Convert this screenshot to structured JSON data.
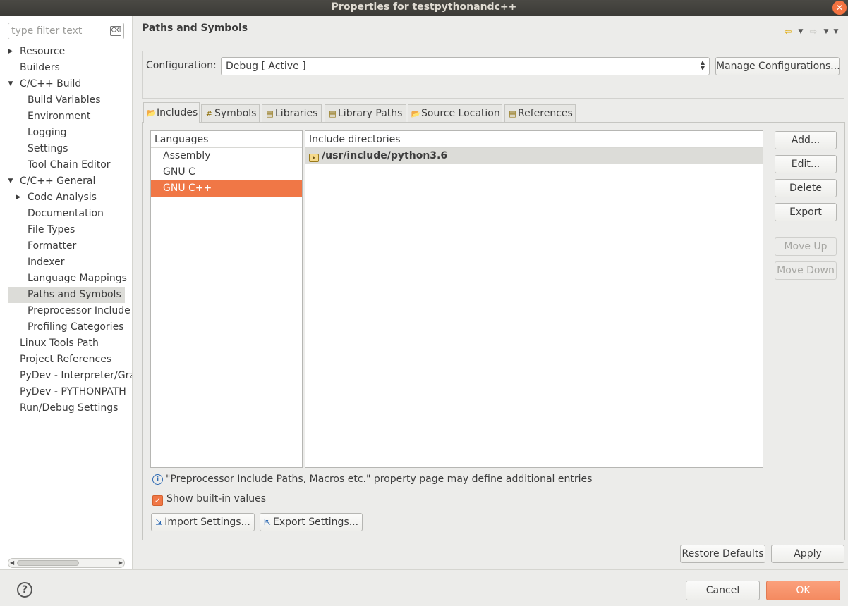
{
  "window": {
    "title": "Properties for testpythonandc++",
    "close_glyph": "✕"
  },
  "filter": {
    "placeholder": "type filter text",
    "clear_glyph": "⌫"
  },
  "tree": [
    {
      "label": "Resource",
      "level": 0,
      "arrow": "▶"
    },
    {
      "label": "Builders",
      "level": 0,
      "arrow": ""
    },
    {
      "label": "C/C++ Build",
      "level": 0,
      "arrow": "▼"
    },
    {
      "label": "Build Variables",
      "level": 1,
      "arrow": ""
    },
    {
      "label": "Environment",
      "level": 1,
      "arrow": ""
    },
    {
      "label": "Logging",
      "level": 1,
      "arrow": ""
    },
    {
      "label": "Settings",
      "level": 1,
      "arrow": ""
    },
    {
      "label": "Tool Chain Editor",
      "level": 1,
      "arrow": ""
    },
    {
      "label": "C/C++ General",
      "level": 0,
      "arrow": "▼"
    },
    {
      "label": "Code Analysis",
      "level": 1,
      "arrow": "▶"
    },
    {
      "label": "Documentation",
      "level": 1,
      "arrow": ""
    },
    {
      "label": "File Types",
      "level": 1,
      "arrow": ""
    },
    {
      "label": "Formatter",
      "level": 1,
      "arrow": ""
    },
    {
      "label": "Indexer",
      "level": 1,
      "arrow": ""
    },
    {
      "label": "Language Mappings",
      "level": 1,
      "arrow": ""
    },
    {
      "label": "Paths and Symbols",
      "level": 1,
      "arrow": "",
      "selected": true
    },
    {
      "label": "Preprocessor Include",
      "level": 1,
      "arrow": ""
    },
    {
      "label": "Profiling Categories",
      "level": 1,
      "arrow": ""
    },
    {
      "label": "Linux Tools Path",
      "level": 0,
      "arrow": ""
    },
    {
      "label": "Project References",
      "level": 0,
      "arrow": ""
    },
    {
      "label": "PyDev - Interpreter/Gra",
      "level": 0,
      "arrow": ""
    },
    {
      "label": "PyDev - PYTHONPATH",
      "level": 0,
      "arrow": ""
    },
    {
      "label": "Run/Debug Settings",
      "level": 0,
      "arrow": ""
    }
  ],
  "page": {
    "title": "Paths and Symbols"
  },
  "nav": {
    "back": "⇦",
    "forward": "⇨",
    "drop": "▼",
    "menu": "▼"
  },
  "config": {
    "label": "Configuration:",
    "value": "Debug  [ Active ]",
    "manage_label": "Manage Configurations..."
  },
  "tabs": [
    {
      "label": "Includes",
      "icon": "📂",
      "active": true
    },
    {
      "label": "Symbols",
      "icon": "#",
      "active": false
    },
    {
      "label": "Libraries",
      "icon": "▤",
      "active": false
    },
    {
      "label": "Library Paths",
      "icon": "▤",
      "active": false
    },
    {
      "label": "Source Location",
      "icon": "📂",
      "active": false
    },
    {
      "label": "References",
      "icon": "▤",
      "active": false
    }
  ],
  "languages": {
    "header": "Languages",
    "items": [
      "Assembly",
      "GNU C",
      "GNU C++"
    ],
    "selected": "GNU C++"
  },
  "includes": {
    "header": "Include directories",
    "items": [
      "/usr/include/python3.6"
    ]
  },
  "side_buttons": {
    "add": "Add...",
    "edit": "Edit...",
    "delete": "Delete",
    "export": "Export",
    "move_up": "Move Up",
    "move_down": "Move Down"
  },
  "info": {
    "glyph": "i",
    "text": "\"Preprocessor Include Paths, Macros etc.\" property page may define additional entries"
  },
  "show_builtin": {
    "label": "Show built-in values",
    "checked": true,
    "glyph": "✓"
  },
  "import_settings": "Import Settings...",
  "export_settings": "Export Settings...",
  "restore_defaults": "Restore Defaults",
  "apply": "Apply",
  "cancel": "Cancel",
  "ok": "OK",
  "help_glyph": "?",
  "colors": {
    "accent": "#f07746",
    "titlebar": "#3c3b37",
    "selection_gray": "#dcdcd8"
  }
}
